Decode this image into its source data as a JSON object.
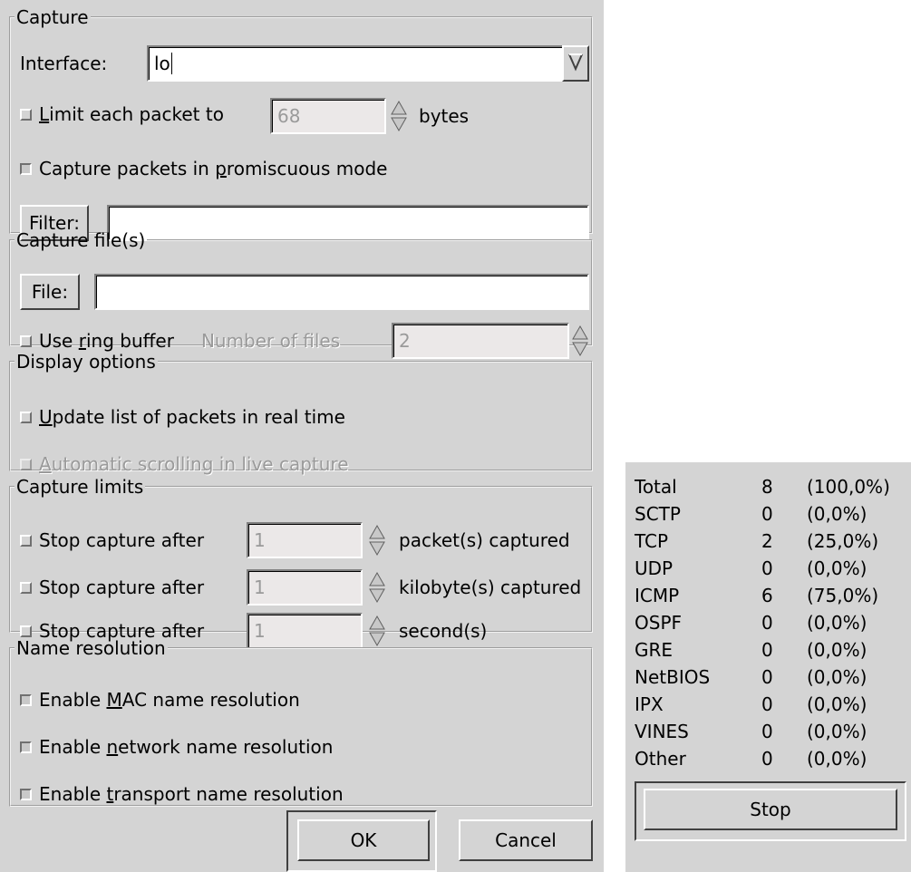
{
  "capture": {
    "legend": "Capture",
    "interface_label": "Interface:",
    "interface_value": "lo",
    "limit_label_pre": "",
    "limit_label_ul": "L",
    "limit_label_post": "imit each packet to",
    "limit_value": "68",
    "bytes_label": "bytes",
    "promisc_pre": "Capture packets in ",
    "promisc_ul": "p",
    "promisc_post": "romiscuous mode",
    "filter_button": "Filter:",
    "filter_value": ""
  },
  "capture_files": {
    "legend": "Capture file(s)",
    "file_button": "File:",
    "file_value": "",
    "ring_pre": "Use ",
    "ring_ul": "r",
    "ring_post": "ing buffer",
    "num_files_label": "Number of files",
    "num_files_value": "2"
  },
  "display_options": {
    "legend": "Display options",
    "update_ul": "U",
    "update_post": "pdate list of packets in real time",
    "autoscroll_ul": "A",
    "autoscroll_post": "utomatic scrolling in live capture"
  },
  "capture_limits": {
    "legend": "Capture limits",
    "rows": [
      {
        "label": "Stop capture after",
        "value": "1",
        "unit": "packet(s) captured"
      },
      {
        "label": "Stop capture after",
        "value": "1",
        "unit": "kilobyte(s) captured"
      },
      {
        "label": "Stop capture after",
        "value": "1",
        "unit": "second(s)"
      }
    ]
  },
  "name_resolution": {
    "legend": "Name resolution",
    "mac_pre": "Enable ",
    "mac_ul": "M",
    "mac_post": "AC name resolution",
    "net_pre": "Enable ",
    "net_ul": "n",
    "net_post": "etwork name resolution",
    "trans_pre": "Enable ",
    "trans_ul": "t",
    "trans_post": "ransport name resolution"
  },
  "buttons": {
    "ok": "OK",
    "cancel": "Cancel"
  },
  "stats": {
    "rows": [
      {
        "name": "Total",
        "count": "8",
        "pct": "(100,0%)"
      },
      {
        "name": "SCTP",
        "count": "0",
        "pct": "(0,0%)"
      },
      {
        "name": "TCP",
        "count": "2",
        "pct": "(25,0%)"
      },
      {
        "name": "UDP",
        "count": "0",
        "pct": "(0,0%)"
      },
      {
        "name": "ICMP",
        "count": "6",
        "pct": "(75,0%)"
      },
      {
        "name": "OSPF",
        "count": "0",
        "pct": "(0,0%)"
      },
      {
        "name": "GRE",
        "count": "0",
        "pct": "(0,0%)"
      },
      {
        "name": "NetBIOS",
        "count": "0",
        "pct": "(0,0%)"
      },
      {
        "name": "IPX",
        "count": "0",
        "pct": "(0,0%)"
      },
      {
        "name": "VINES",
        "count": "0",
        "pct": "(0,0%)"
      },
      {
        "name": "Other",
        "count": "0",
        "pct": "(0,0%)"
      }
    ],
    "stop_button": "Stop"
  }
}
